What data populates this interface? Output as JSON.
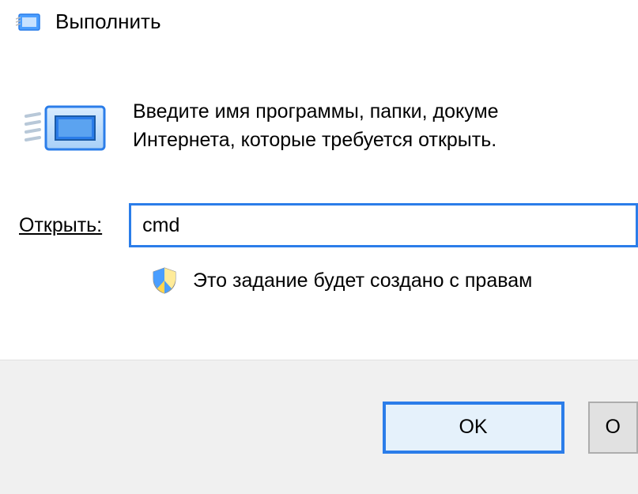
{
  "titlebar": {
    "title": "Выполнить"
  },
  "content": {
    "description": "Введите имя программы, папки, докуме\nИнтернета, которые требуется открыть."
  },
  "form": {
    "open_label": "Открыть:",
    "input_value": "cmd",
    "admin_text": "Это задание будет создано с правам"
  },
  "buttons": {
    "ok": "OK",
    "cancel": "О"
  },
  "icons": {
    "run": "run-icon",
    "shield": "shield-icon"
  }
}
